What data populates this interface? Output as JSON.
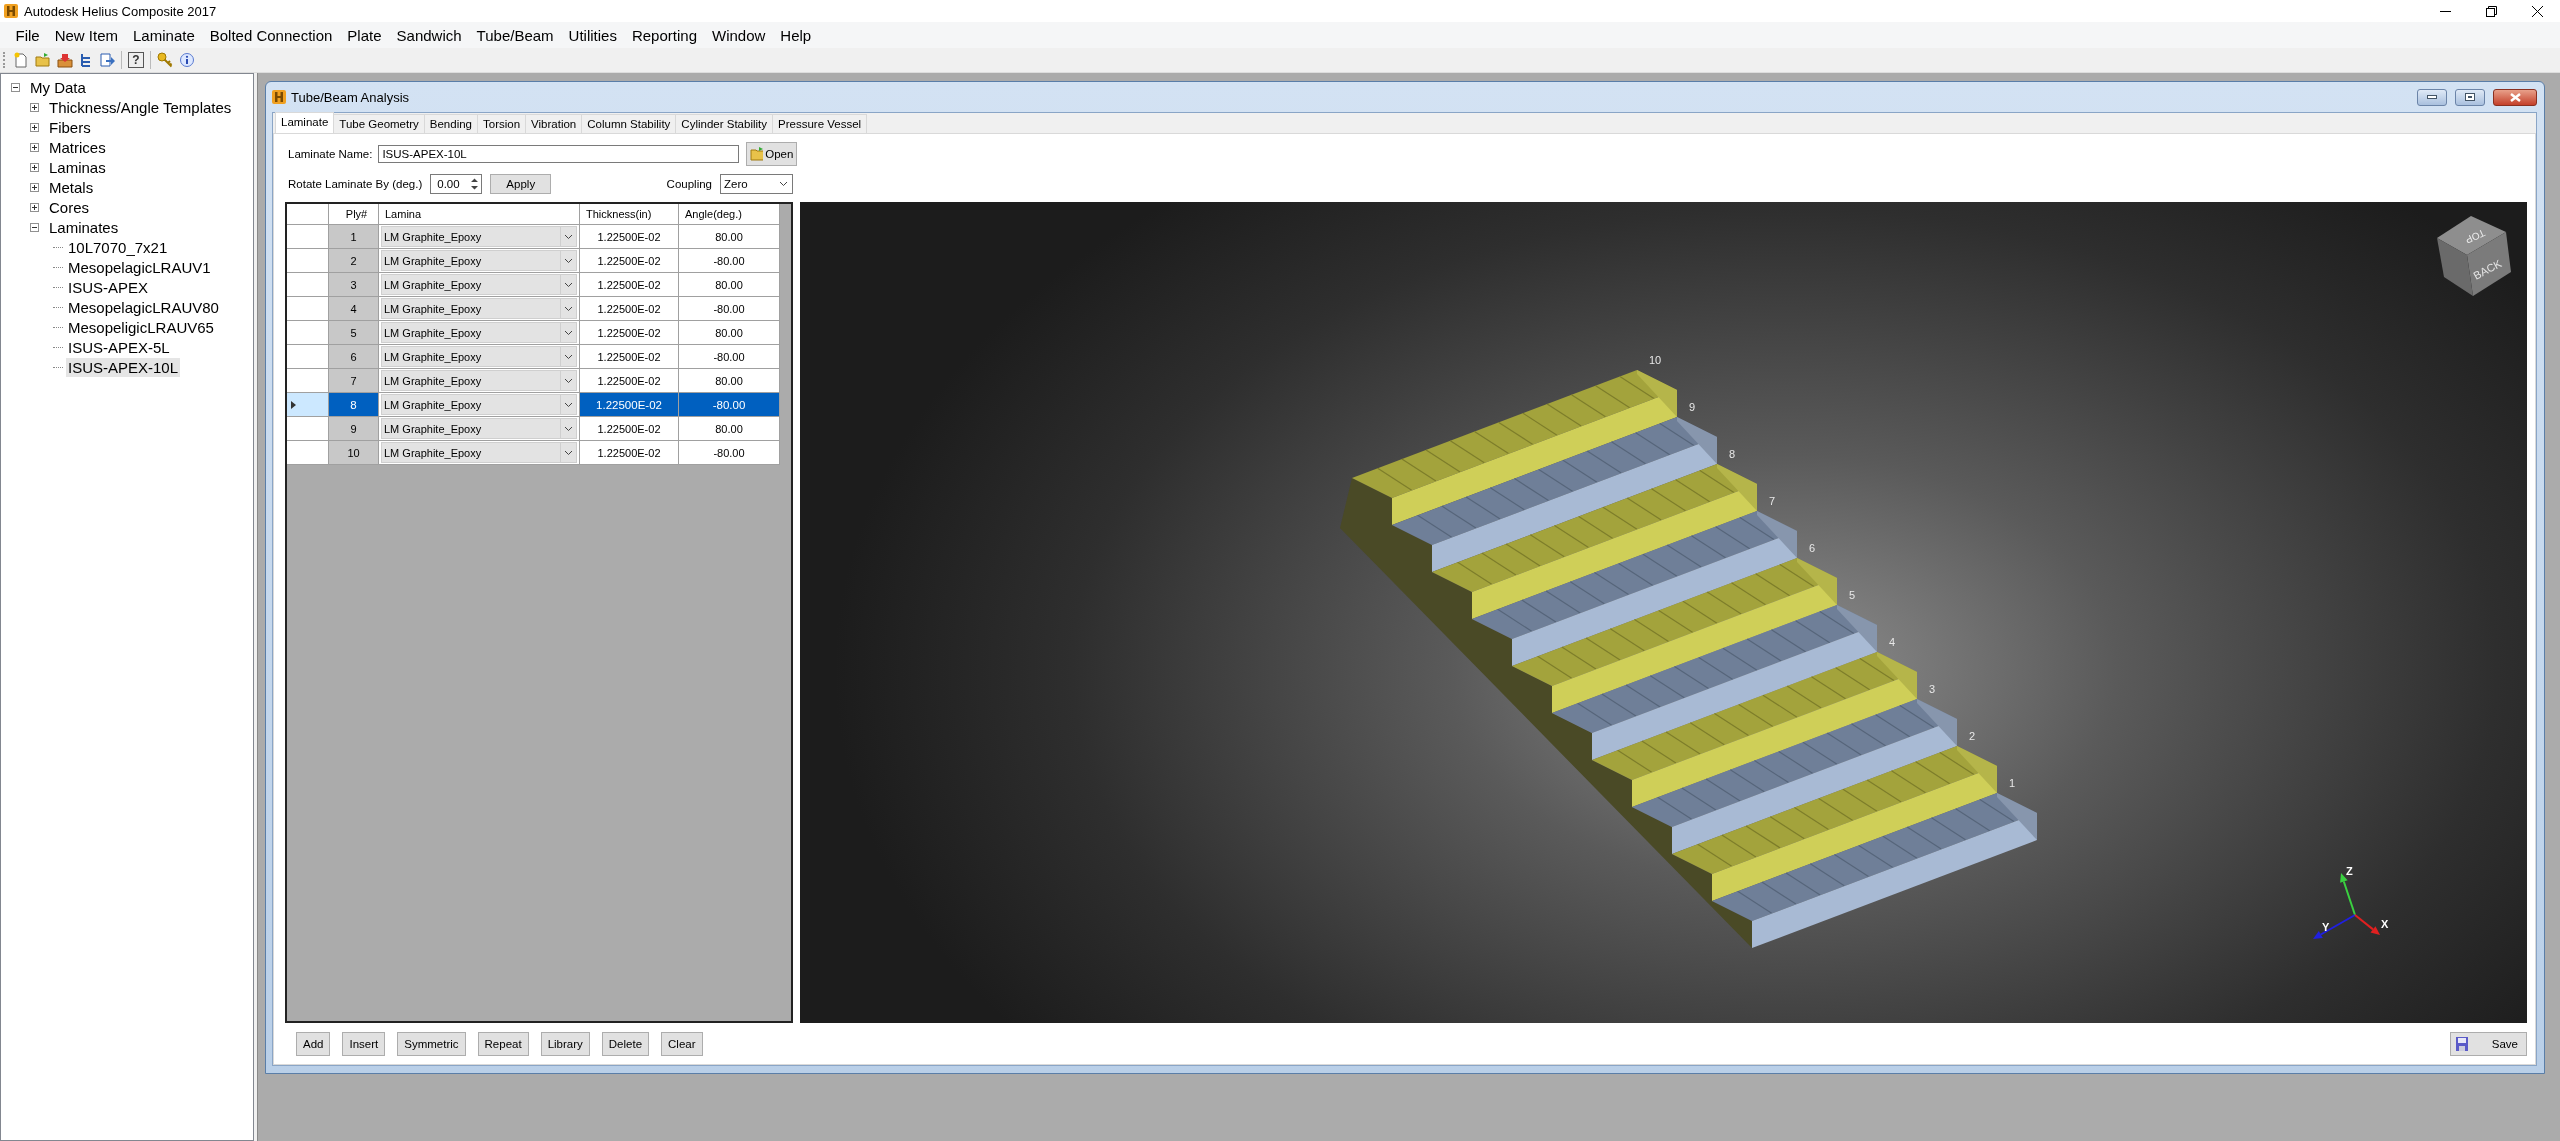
{
  "app": {
    "title": "Autodesk Helius Composite 2017"
  },
  "menu": [
    "File",
    "New Item",
    "Laminate",
    "Bolted Connection",
    "Plate",
    "Sandwich",
    "Tube/Beam",
    "Utilities",
    "Reporting",
    "Window",
    "Help"
  ],
  "toolbar": {
    "help_glyph": "?"
  },
  "tree": {
    "label": "My Data",
    "expanded": true,
    "selected": false,
    "children": [
      {
        "label": "Thickness/Angle Templates",
        "expanded": false,
        "selected": false
      },
      {
        "label": "Fibers",
        "expanded": false,
        "selected": false
      },
      {
        "label": "Matrices",
        "expanded": false,
        "selected": false
      },
      {
        "label": "Laminas",
        "expanded": false,
        "selected": false
      },
      {
        "label": "Metals",
        "expanded": false,
        "selected": false
      },
      {
        "label": "Cores",
        "expanded": false,
        "selected": false
      },
      {
        "label": "Laminates",
        "expanded": true,
        "selected": false,
        "children": [
          {
            "label": "10L7070_7x21",
            "selected": false
          },
          {
            "label": "MesopelagicLRAUV1",
            "selected": false
          },
          {
            "label": "ISUS-APEX",
            "selected": false
          },
          {
            "label": "MesopelagicLRAUV80",
            "selected": false
          },
          {
            "label": "MesopeligicLRAUV65",
            "selected": false
          },
          {
            "label": "ISUS-APEX-5L",
            "selected": false
          },
          {
            "label": "ISUS-APEX-10L",
            "selected": true
          }
        ]
      }
    ]
  },
  "child_window": {
    "title": "Tube/Beam Analysis",
    "tabs": [
      {
        "label": "Laminate",
        "selected": true
      },
      {
        "label": "Tube Geometry",
        "selected": false
      },
      {
        "label": "Bending",
        "selected": false
      },
      {
        "label": "Torsion",
        "selected": false
      },
      {
        "label": "Vibration",
        "selected": false
      },
      {
        "label": "Column Stability",
        "selected": false
      },
      {
        "label": "Cylinder Stability",
        "selected": false
      },
      {
        "label": "Pressure Vessel",
        "selected": false
      }
    ],
    "laminate_name": {
      "label": "Laminate Name:",
      "value": "ISUS-APEX-10L",
      "button": "Open"
    },
    "rotate": {
      "label": "Rotate Laminate By (deg.)",
      "value": "0.00",
      "button": "Apply"
    },
    "coupling": {
      "label": "Coupling",
      "value": "Zero"
    },
    "table": {
      "columns": [
        "Ply#",
        "Lamina",
        "Thickness(in)",
        "Angle(deg.)"
      ],
      "rows": [
        {
          "ply": "1",
          "lamina": "LM Graphite_Epoxy",
          "thickness": "1.22500E-02",
          "angle": "80.00",
          "selected": false
        },
        {
          "ply": "2",
          "lamina": "LM Graphite_Epoxy",
          "thickness": "1.22500E-02",
          "angle": "-80.00",
          "selected": false
        },
        {
          "ply": "3",
          "lamina": "LM Graphite_Epoxy",
          "thickness": "1.22500E-02",
          "angle": "80.00",
          "selected": false
        },
        {
          "ply": "4",
          "lamina": "LM Graphite_Epoxy",
          "thickness": "1.22500E-02",
          "angle": "-80.00",
          "selected": false
        },
        {
          "ply": "5",
          "lamina": "LM Graphite_Epoxy",
          "thickness": "1.22500E-02",
          "angle": "80.00",
          "selected": false
        },
        {
          "ply": "6",
          "lamina": "LM Graphite_Epoxy",
          "thickness": "1.22500E-02",
          "angle": "-80.00",
          "selected": false
        },
        {
          "ply": "7",
          "lamina": "LM Graphite_Epoxy",
          "thickness": "1.22500E-02",
          "angle": "80.00",
          "selected": false
        },
        {
          "ply": "8",
          "lamina": "LM Graphite_Epoxy",
          "thickness": "1.22500E-02",
          "angle": "-80.00",
          "selected": true
        },
        {
          "ply": "9",
          "lamina": "LM Graphite_Epoxy",
          "thickness": "1.22500E-02",
          "angle": "80.00",
          "selected": false
        },
        {
          "ply": "10",
          "lamina": "LM Graphite_Epoxy",
          "thickness": "1.22500E-02",
          "angle": "-80.00",
          "selected": false
        }
      ]
    },
    "viewport": {
      "ply_labels": [
        "1",
        "2",
        "3",
        "4",
        "5",
        "6",
        "7",
        "8",
        "9",
        "10"
      ],
      "view_cube": [
        "TOP",
        "BACK"
      ],
      "axes": [
        "Z",
        "Y",
        "X"
      ]
    },
    "buttons": [
      "Add",
      "Insert",
      "Symmetric",
      "Repeat",
      "Library",
      "Delete",
      "Clear"
    ],
    "save_button": "Save"
  }
}
